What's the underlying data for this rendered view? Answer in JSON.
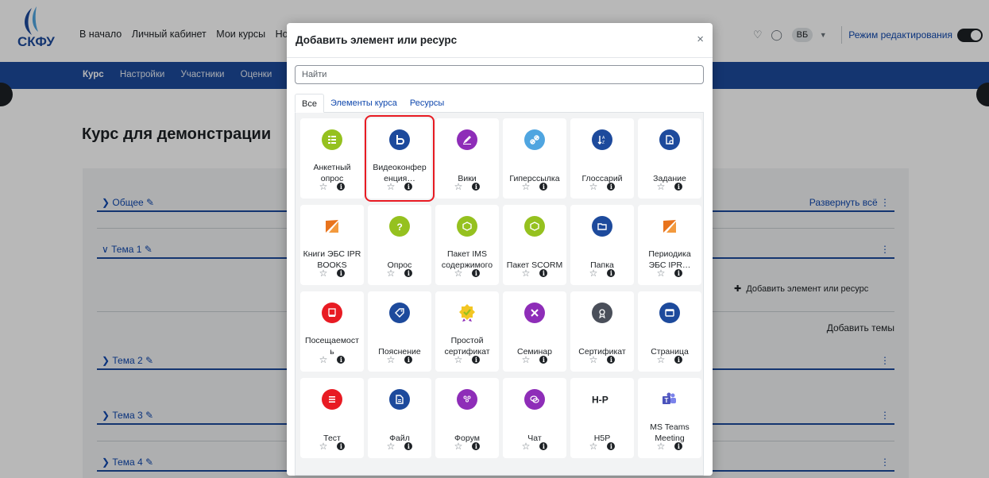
{
  "header": {
    "logo_text": "СКФУ",
    "nav": [
      "В начало",
      "Личный кабинет",
      "Мои курсы",
      "Нормати"
    ],
    "avatar": "ВБ",
    "edit_mode_label": "Режим редактирования"
  },
  "course_nav": {
    "items": [
      "Курс",
      "Настройки",
      "Участники",
      "Оценки"
    ]
  },
  "course": {
    "title": "Курс для демонстрации",
    "expand_all": "Развернуть всё",
    "add_activity": "Добавить элемент или ресурс",
    "add_topics": "Добавить темы",
    "sections": [
      "Общее",
      "Тема 1",
      "Тема 2",
      "Тема 3",
      "Тема 4"
    ]
  },
  "modal": {
    "title": "Добавить элемент или ресурс",
    "close": "×",
    "search_placeholder": "Найти",
    "tabs": [
      "Все",
      "Элементы курса",
      "Ресурсы"
    ],
    "items": [
      {
        "label1": "Анкетный",
        "label2": "опрос",
        "icon": "feedback-icon",
        "color": "#95c11f"
      },
      {
        "label1": "Видеоконфер",
        "label2": "енция…",
        "icon": "bigbluebutton-icon",
        "color": "#1d4a9c"
      },
      {
        "label1": "",
        "label2": "Вики",
        "icon": "wiki-icon",
        "color": "#8e2db8"
      },
      {
        "label1": "",
        "label2": "Гиперссылка",
        "icon": "url-icon",
        "color": "#4fa5e0"
      },
      {
        "label1": "",
        "label2": "Глоссарий",
        "icon": "glossary-icon",
        "color": "#1d4a9c"
      },
      {
        "label1": "",
        "label2": "Задание",
        "icon": "assignment-icon",
        "color": "#1d4a9c"
      },
      {
        "label1": "Книги ЭБС IPR",
        "label2": "BOOKS",
        "icon": "ipr-books-icon",
        "color": "#e8731c"
      },
      {
        "label1": "",
        "label2": "Опрос",
        "icon": "choice-icon",
        "color": "#95c11f"
      },
      {
        "label1": "Пакет IMS",
        "label2": "содержимого",
        "icon": "ims-package-icon",
        "color": "#95c11f"
      },
      {
        "label1": "",
        "label2": "Пакет SCORM",
        "icon": "scorm-icon",
        "color": "#95c11f"
      },
      {
        "label1": "",
        "label2": "Папка",
        "icon": "folder-icon",
        "color": "#1d4a9c"
      },
      {
        "label1": "Периодика",
        "label2": "ЭБС IPR…",
        "icon": "ipr-periodicals-icon",
        "color": "#e8731c"
      },
      {
        "label1": "Посещаемост",
        "label2": "ь",
        "icon": "attendance-icon",
        "color": "#e81b23"
      },
      {
        "label1": "",
        "label2": "Пояснение",
        "icon": "label-icon",
        "color": "#1d4a9c"
      },
      {
        "label1": "Простой",
        "label2": "сертификат",
        "icon": "simple-certificate-icon",
        "color": "#95c11f"
      },
      {
        "label1": "",
        "label2": "Семинар",
        "icon": "workshop-icon",
        "color": "#8e2db8"
      },
      {
        "label1": "",
        "label2": "Сертификат",
        "icon": "certificate-icon",
        "color": "#4a4f5a"
      },
      {
        "label1": "",
        "label2": "Страница",
        "icon": "page-icon",
        "color": "#1d4a9c"
      },
      {
        "label1": "",
        "label2": "Тест",
        "icon": "quiz-icon",
        "color": "#e81b23"
      },
      {
        "label1": "",
        "label2": "Файл",
        "icon": "file-icon",
        "color": "#1d4a9c"
      },
      {
        "label1": "",
        "label2": "Форум",
        "icon": "forum-icon",
        "color": "#8e2db8"
      },
      {
        "label1": "",
        "label2": "Чат",
        "icon": "chat-icon",
        "color": "#8e2db8"
      },
      {
        "label1": "",
        "label2": "H5P",
        "icon": "h5p-icon",
        "color": "#1d2125"
      },
      {
        "label1": "MS Teams",
        "label2": "Meeting",
        "icon": "ms-teams-icon",
        "color": "#5b5fc7"
      }
    ]
  },
  "colors": {
    "primary": "#1d4a9c",
    "link": "#0f47ad",
    "highlight": "#e81b23"
  }
}
